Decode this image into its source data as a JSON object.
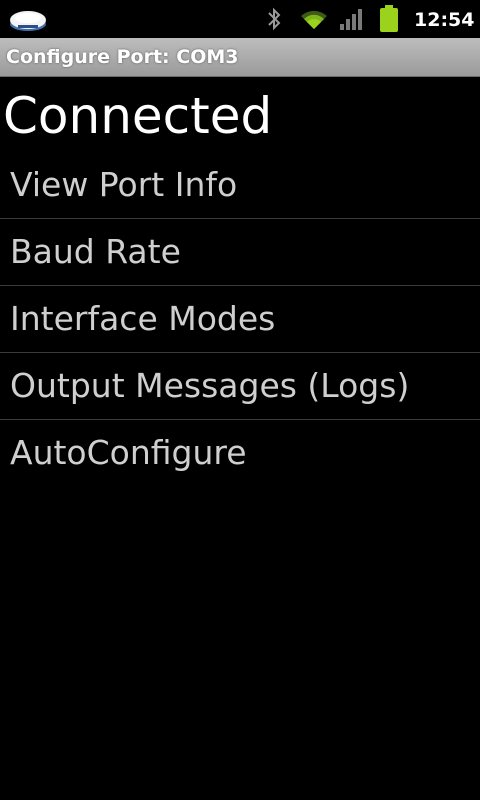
{
  "status_bar": {
    "time": "12:54",
    "icons": [
      "gps-device-icon",
      "bluetooth-icon",
      "wifi-icon",
      "signal-icon",
      "battery-icon"
    ]
  },
  "title_bar": {
    "title": "Configure Port: COM3"
  },
  "connection": {
    "status": "Connected"
  },
  "menu": {
    "items": [
      {
        "label": "View Port Info"
      },
      {
        "label": "Baud Rate"
      },
      {
        "label": "Interface Modes"
      },
      {
        "label": "Output Messages (Logs)"
      },
      {
        "label": "AutoConfigure"
      }
    ]
  },
  "colors": {
    "background": "#000000",
    "title_bar": "#a8a8a8",
    "menu_text": "#cfcfcf",
    "divider": "#3a3a3a",
    "battery": "#9bd31c"
  }
}
